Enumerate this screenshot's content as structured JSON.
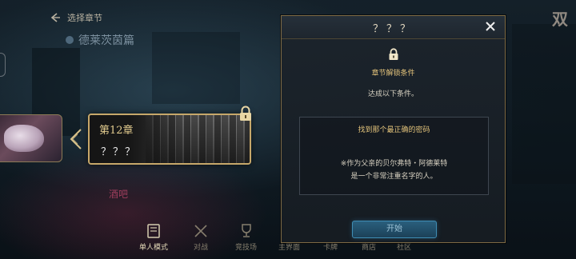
{
  "header": {
    "back_label": "选择章节",
    "region_name": "德莱茨茵篇"
  },
  "chapter": {
    "number_label": "第12章",
    "name": "？？？"
  },
  "background": {
    "neon_sign": "酒吧",
    "corner_text": "双"
  },
  "bottom_nav": [
    {
      "label": "单人模式",
      "icon": "book-icon"
    },
    {
      "label": "对战",
      "icon": "crossed-swords-icon"
    },
    {
      "label": "竞技场",
      "icon": "trophy-icon"
    },
    {
      "label": "主界面",
      "icon": ""
    },
    {
      "label": "卡牌",
      "icon": ""
    },
    {
      "label": "商店",
      "icon": ""
    },
    {
      "label": "社区",
      "icon": ""
    }
  ],
  "dialog": {
    "title": "？？？",
    "condition_title": "章节解锁条件",
    "condition_subtitle": "达成以下条件。",
    "requirement_title": "找到那个最正确的密码",
    "requirement_hint_line1": "※作为父亲的贝尔弗特・阿德莱特",
    "requirement_hint_line2": "是一个非常注重名字的人。",
    "start_button": "开始"
  },
  "colors": {
    "gold_accent": "#c7a86a",
    "condition_gold": "#e2c27a",
    "button_blue": "#2a5f7d"
  }
}
